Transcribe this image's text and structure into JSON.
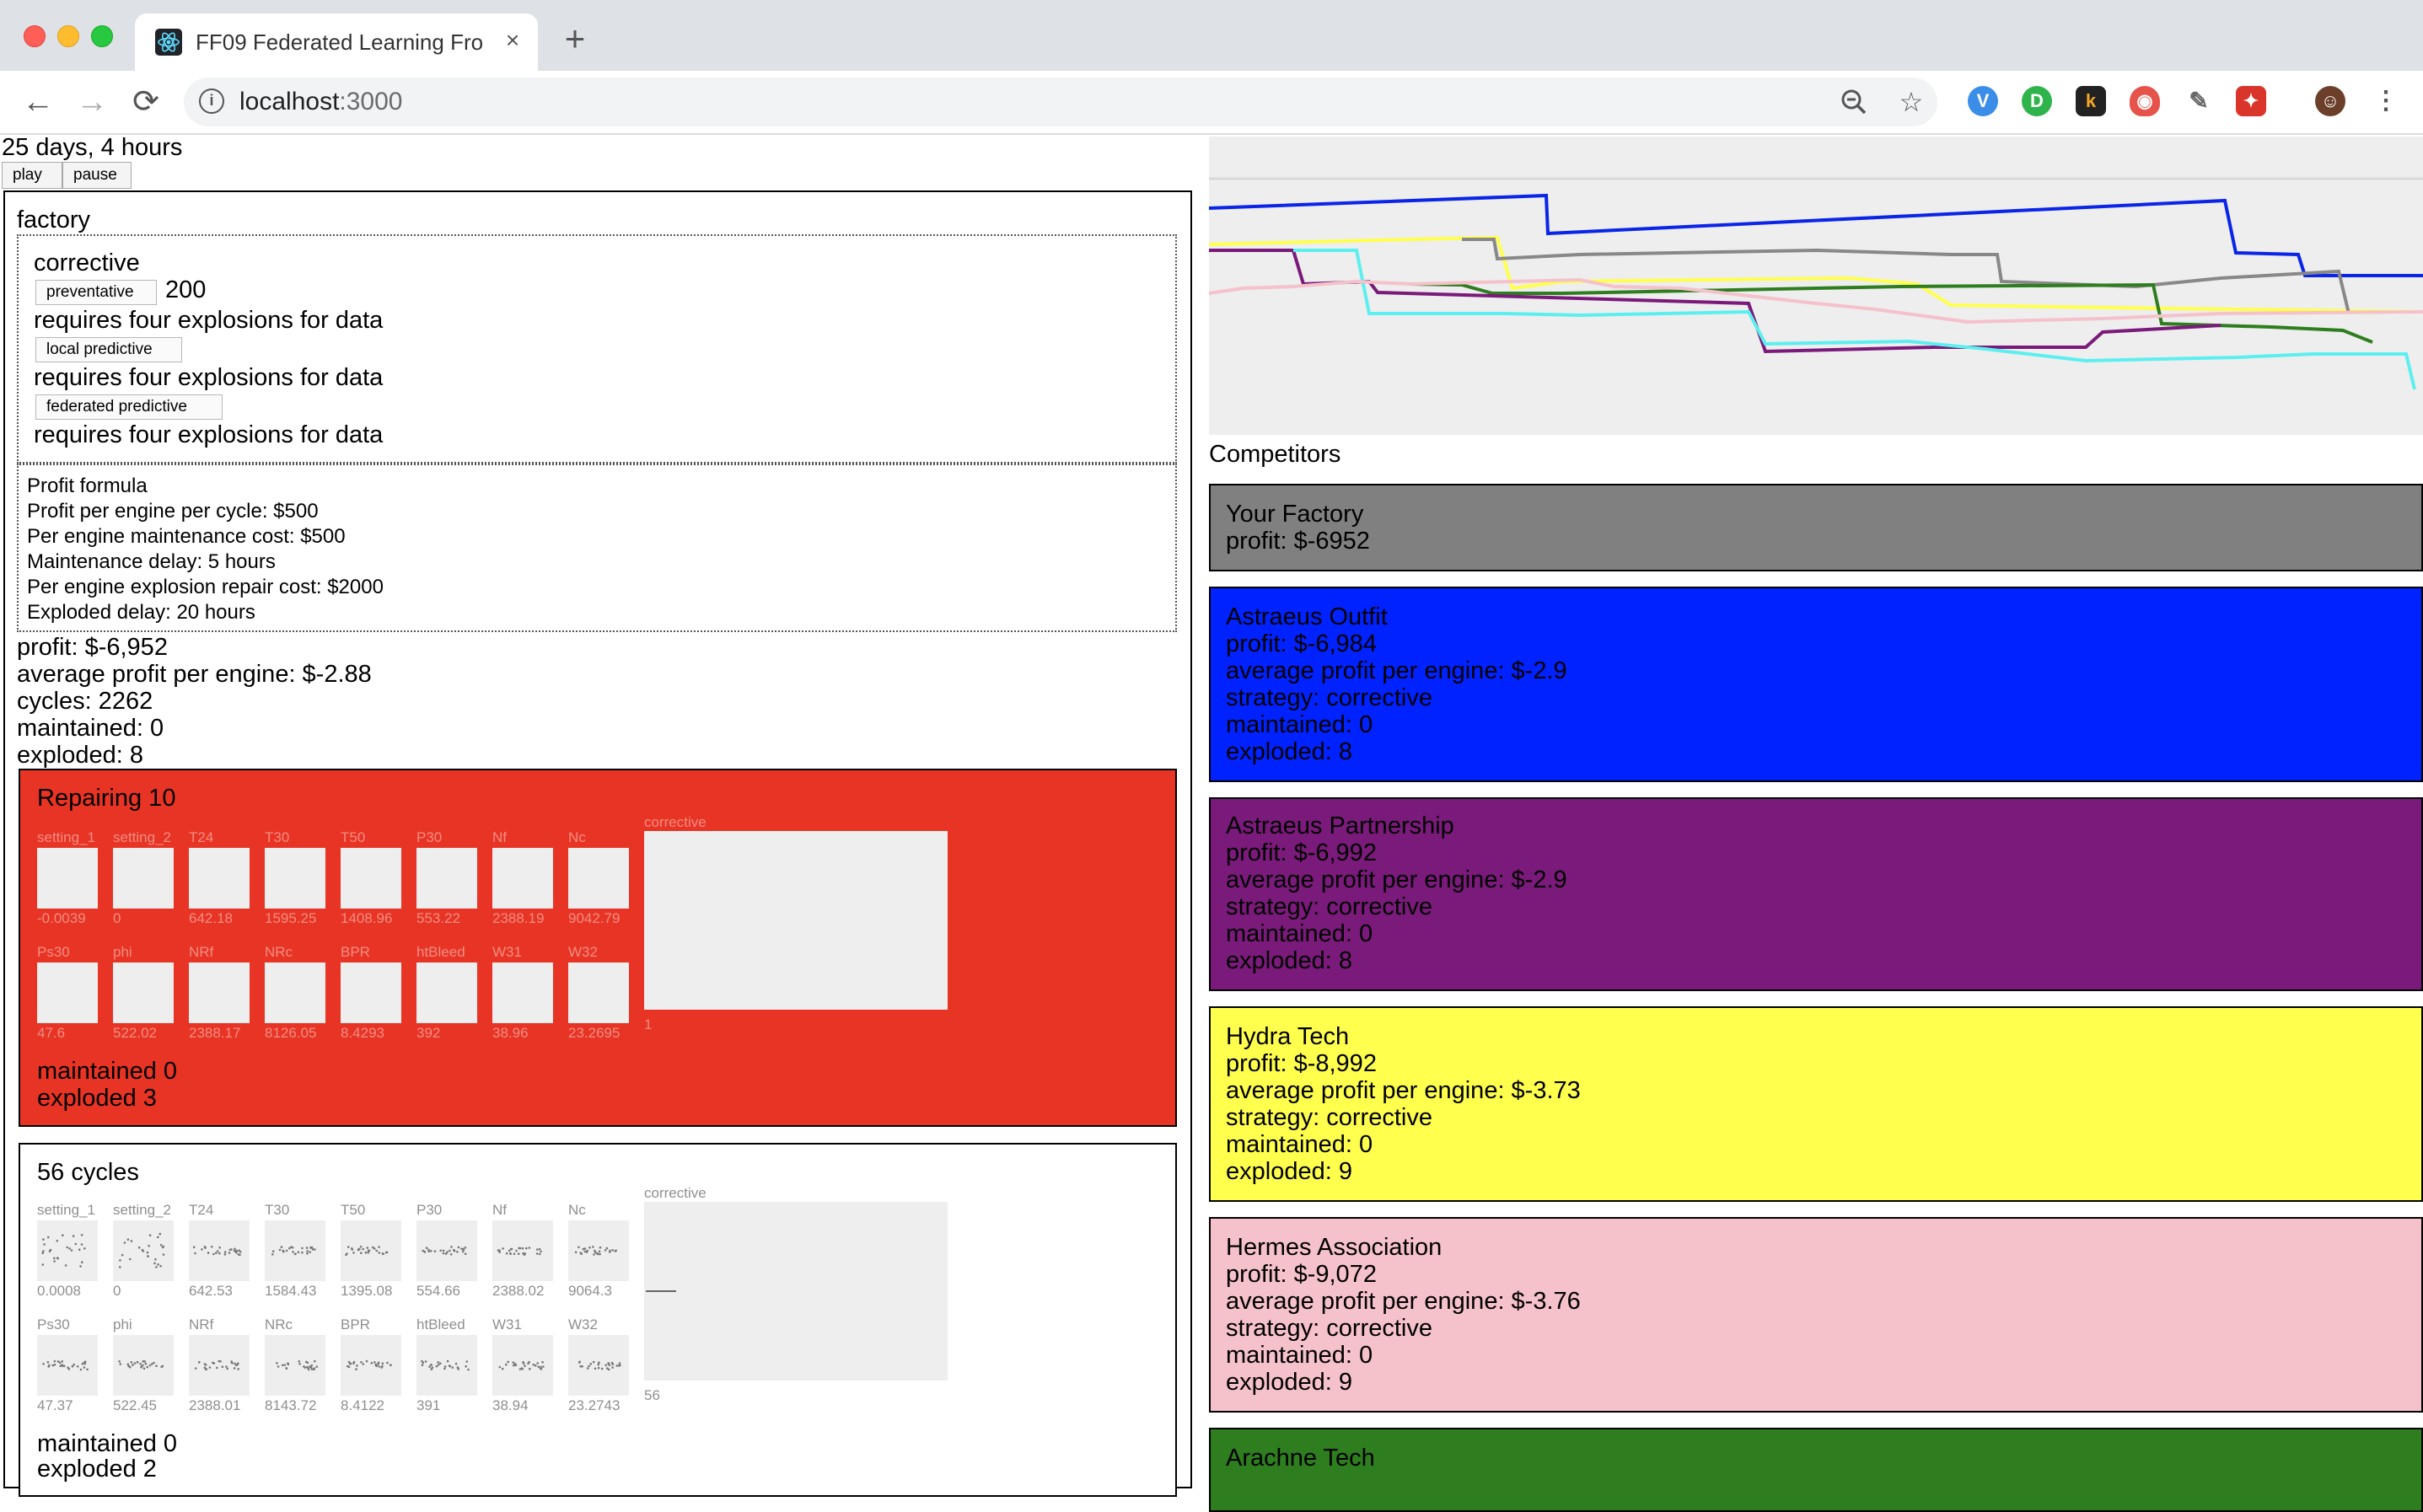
{
  "browser": {
    "tab_title": "FF09 Federated Learning Front",
    "tab_close": "×",
    "new_tab": "+",
    "url_host": "localhost",
    "url_port": ":3000",
    "back": "←",
    "forward": "→",
    "reload": "⟳"
  },
  "sim": {
    "elapsed": "25 days, 4 hours",
    "play_label": "play",
    "pause_label": "pause"
  },
  "factory": {
    "title": "factory",
    "strategies": {
      "current": "corrective",
      "preventative_label": "preventative",
      "preventative_value": "200",
      "preventative_note": "requires four explosions for data",
      "local_label": "local predictive",
      "local_note": "requires four explosions for data",
      "federated_label": "federated predictive",
      "federated_note": "requires four explosions for data"
    },
    "profit_formula": {
      "title": "Profit formula",
      "lines": [
        "Profit per engine per cycle: $500",
        "Per engine maintenance cost: $500",
        "Maintenance delay: 5 hours",
        "Per engine explosion repair cost: $2000",
        "Exploded delay: 20 hours"
      ]
    },
    "stats": {
      "profit": "profit: $-6,952",
      "avg_profit": "average profit per engine: $-2.88",
      "cycles": "cycles: 2262",
      "maintained": "maintained: 0",
      "exploded": "exploded: 8"
    },
    "groups": [
      {
        "title": "Repairing 10",
        "sensors": [
          {
            "label": "setting_1",
            "value": "-0.0039"
          },
          {
            "label": "setting_2",
            "value": "0"
          },
          {
            "label": "T24",
            "value": "642.18"
          },
          {
            "label": "T30",
            "value": "1595.25"
          },
          {
            "label": "T50",
            "value": "1408.96"
          },
          {
            "label": "P30",
            "value": "553.22"
          },
          {
            "label": "Nf",
            "value": "2388.19"
          },
          {
            "label": "Nc",
            "value": "9042.79"
          },
          {
            "label": "Ps30",
            "value": "47.6"
          },
          {
            "label": "phi",
            "value": "522.02"
          },
          {
            "label": "NRf",
            "value": "2388.17"
          },
          {
            "label": "NRc",
            "value": "8126.05"
          },
          {
            "label": "BPR",
            "value": "8.4293"
          },
          {
            "label": "htBleed",
            "value": "392"
          },
          {
            "label": "W31",
            "value": "38.96"
          },
          {
            "label": "W32",
            "value": "23.2695"
          }
        ],
        "plot_label": "corrective",
        "plot_value": "1",
        "maintained": "maintained 0",
        "exploded": "exploded 3"
      },
      {
        "title": "56 cycles",
        "sensors": [
          {
            "label": "setting_1",
            "value": "0.0008"
          },
          {
            "label": "setting_2",
            "value": "0"
          },
          {
            "label": "T24",
            "value": "642.53"
          },
          {
            "label": "T30",
            "value": "1584.43"
          },
          {
            "label": "T50",
            "value": "1395.08"
          },
          {
            "label": "P30",
            "value": "554.66"
          },
          {
            "label": "Nf",
            "value": "2388.02"
          },
          {
            "label": "Nc",
            "value": "9064.3"
          },
          {
            "label": "Ps30",
            "value": "47.37"
          },
          {
            "label": "phi",
            "value": "522.45"
          },
          {
            "label": "NRf",
            "value": "2388.01"
          },
          {
            "label": "NRc",
            "value": "8143.72"
          },
          {
            "label": "BPR",
            "value": "8.4122"
          },
          {
            "label": "htBleed",
            "value": "391"
          },
          {
            "label": "W31",
            "value": "38.94"
          },
          {
            "label": "W32",
            "value": "23.2743"
          }
        ],
        "plot_label": "corrective",
        "plot_value": "56",
        "maintained": "maintained 0",
        "exploded": "exploded 2"
      }
    ]
  },
  "competitors": {
    "title": "Competitors",
    "list": [
      {
        "name": "Your Factory",
        "profit": "profit: $-6952",
        "color": "#808080"
      },
      {
        "name": "Astraeus Outfit",
        "profit": "profit: $-6,984",
        "avg": "average profit per engine: $-2.9",
        "strategy": "strategy: corrective",
        "maintained": "maintained: 0",
        "exploded": "exploded: 8",
        "color": "#0022ff"
      },
      {
        "name": "Astraeus Partnership",
        "profit": "profit: $-6,992",
        "avg": "average profit per engine: $-2.9",
        "strategy": "strategy: corrective",
        "maintained": "maintained: 0",
        "exploded": "exploded: 8",
        "color": "#7a1a7a"
      },
      {
        "name": "Hydra Tech",
        "profit": "profit: $-8,992",
        "avg": "average profit per engine: $-3.73",
        "strategy": "strategy: corrective",
        "maintained": "maintained: 0",
        "exploded": "exploded: 9",
        "color": "#ffff4d"
      },
      {
        "name": "Hermes Association",
        "profit": "profit: $-9,072",
        "avg": "average profit per engine: $-3.76",
        "strategy": "strategy: corrective",
        "maintained": "maintained: 0",
        "exploded": "exploded: 9",
        "color": "#f5c1ca"
      },
      {
        "name": "Arachne Tech",
        "color": "#2e7d1e"
      }
    ]
  }
}
